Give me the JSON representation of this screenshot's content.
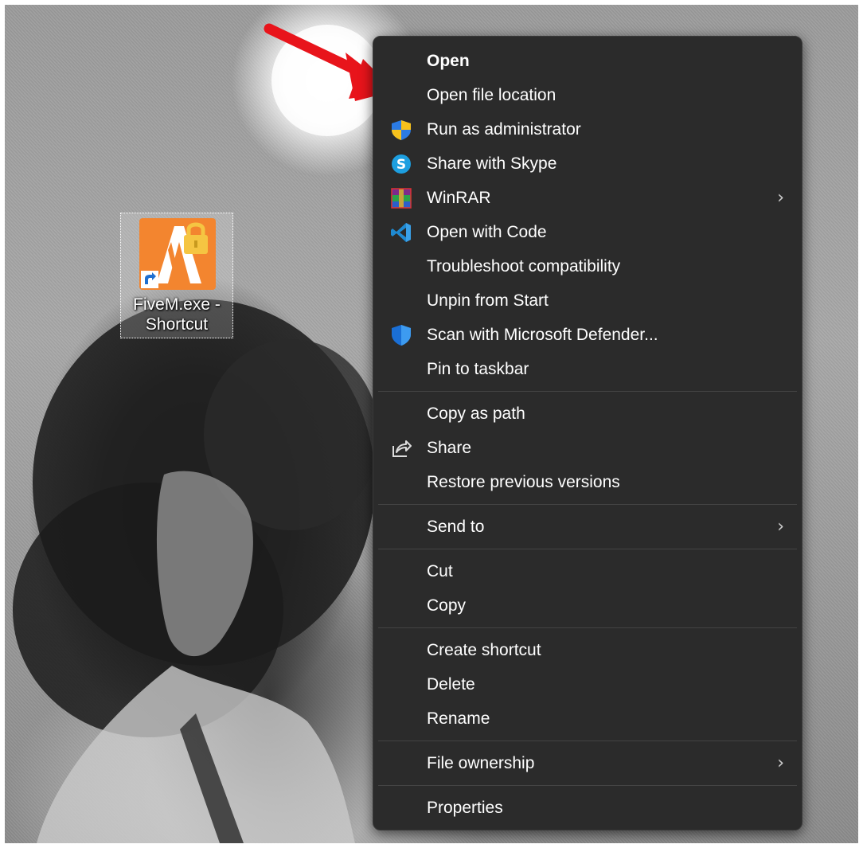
{
  "desktop": {
    "icon": {
      "label": "FiveM.exe -\nShortcut",
      "icon_name": "fivem-app-icon",
      "overlay": "lock-icon",
      "shortcut_badge": "shortcut-arrow-icon",
      "colors": {
        "primary": "#f3852f",
        "lock": "#f5c542"
      }
    }
  },
  "annotation": {
    "color": "#e8141b",
    "icon_name": "red-arrow-icon"
  },
  "context_menu": {
    "background": "#2b2b2b",
    "groups": [
      [
        {
          "label": "Open",
          "bold": true
        },
        {
          "label": "Open file location"
        },
        {
          "label": "Run as administrator",
          "icon": "uac-shield-icon"
        },
        {
          "label": "Share with Skype",
          "icon": "skype-icon"
        },
        {
          "label": "WinRAR",
          "icon": "winrar-icon",
          "submenu": true
        },
        {
          "label": "Open with Code",
          "icon": "vscode-icon"
        },
        {
          "label": "Troubleshoot compatibility"
        },
        {
          "label": "Unpin from Start"
        },
        {
          "label": "Scan with Microsoft Defender...",
          "icon": "defender-shield-icon"
        },
        {
          "label": "Pin to taskbar"
        }
      ],
      [
        {
          "label": "Copy as path"
        },
        {
          "label": "Share",
          "icon": "share-icon"
        },
        {
          "label": "Restore previous versions"
        }
      ],
      [
        {
          "label": "Send to",
          "submenu": true
        }
      ],
      [
        {
          "label": "Cut"
        },
        {
          "label": "Copy"
        }
      ],
      [
        {
          "label": "Create shortcut"
        },
        {
          "label": "Delete"
        },
        {
          "label": "Rename"
        }
      ],
      [
        {
          "label": "File ownership",
          "submenu": true
        }
      ],
      [
        {
          "label": "Properties"
        }
      ]
    ]
  }
}
